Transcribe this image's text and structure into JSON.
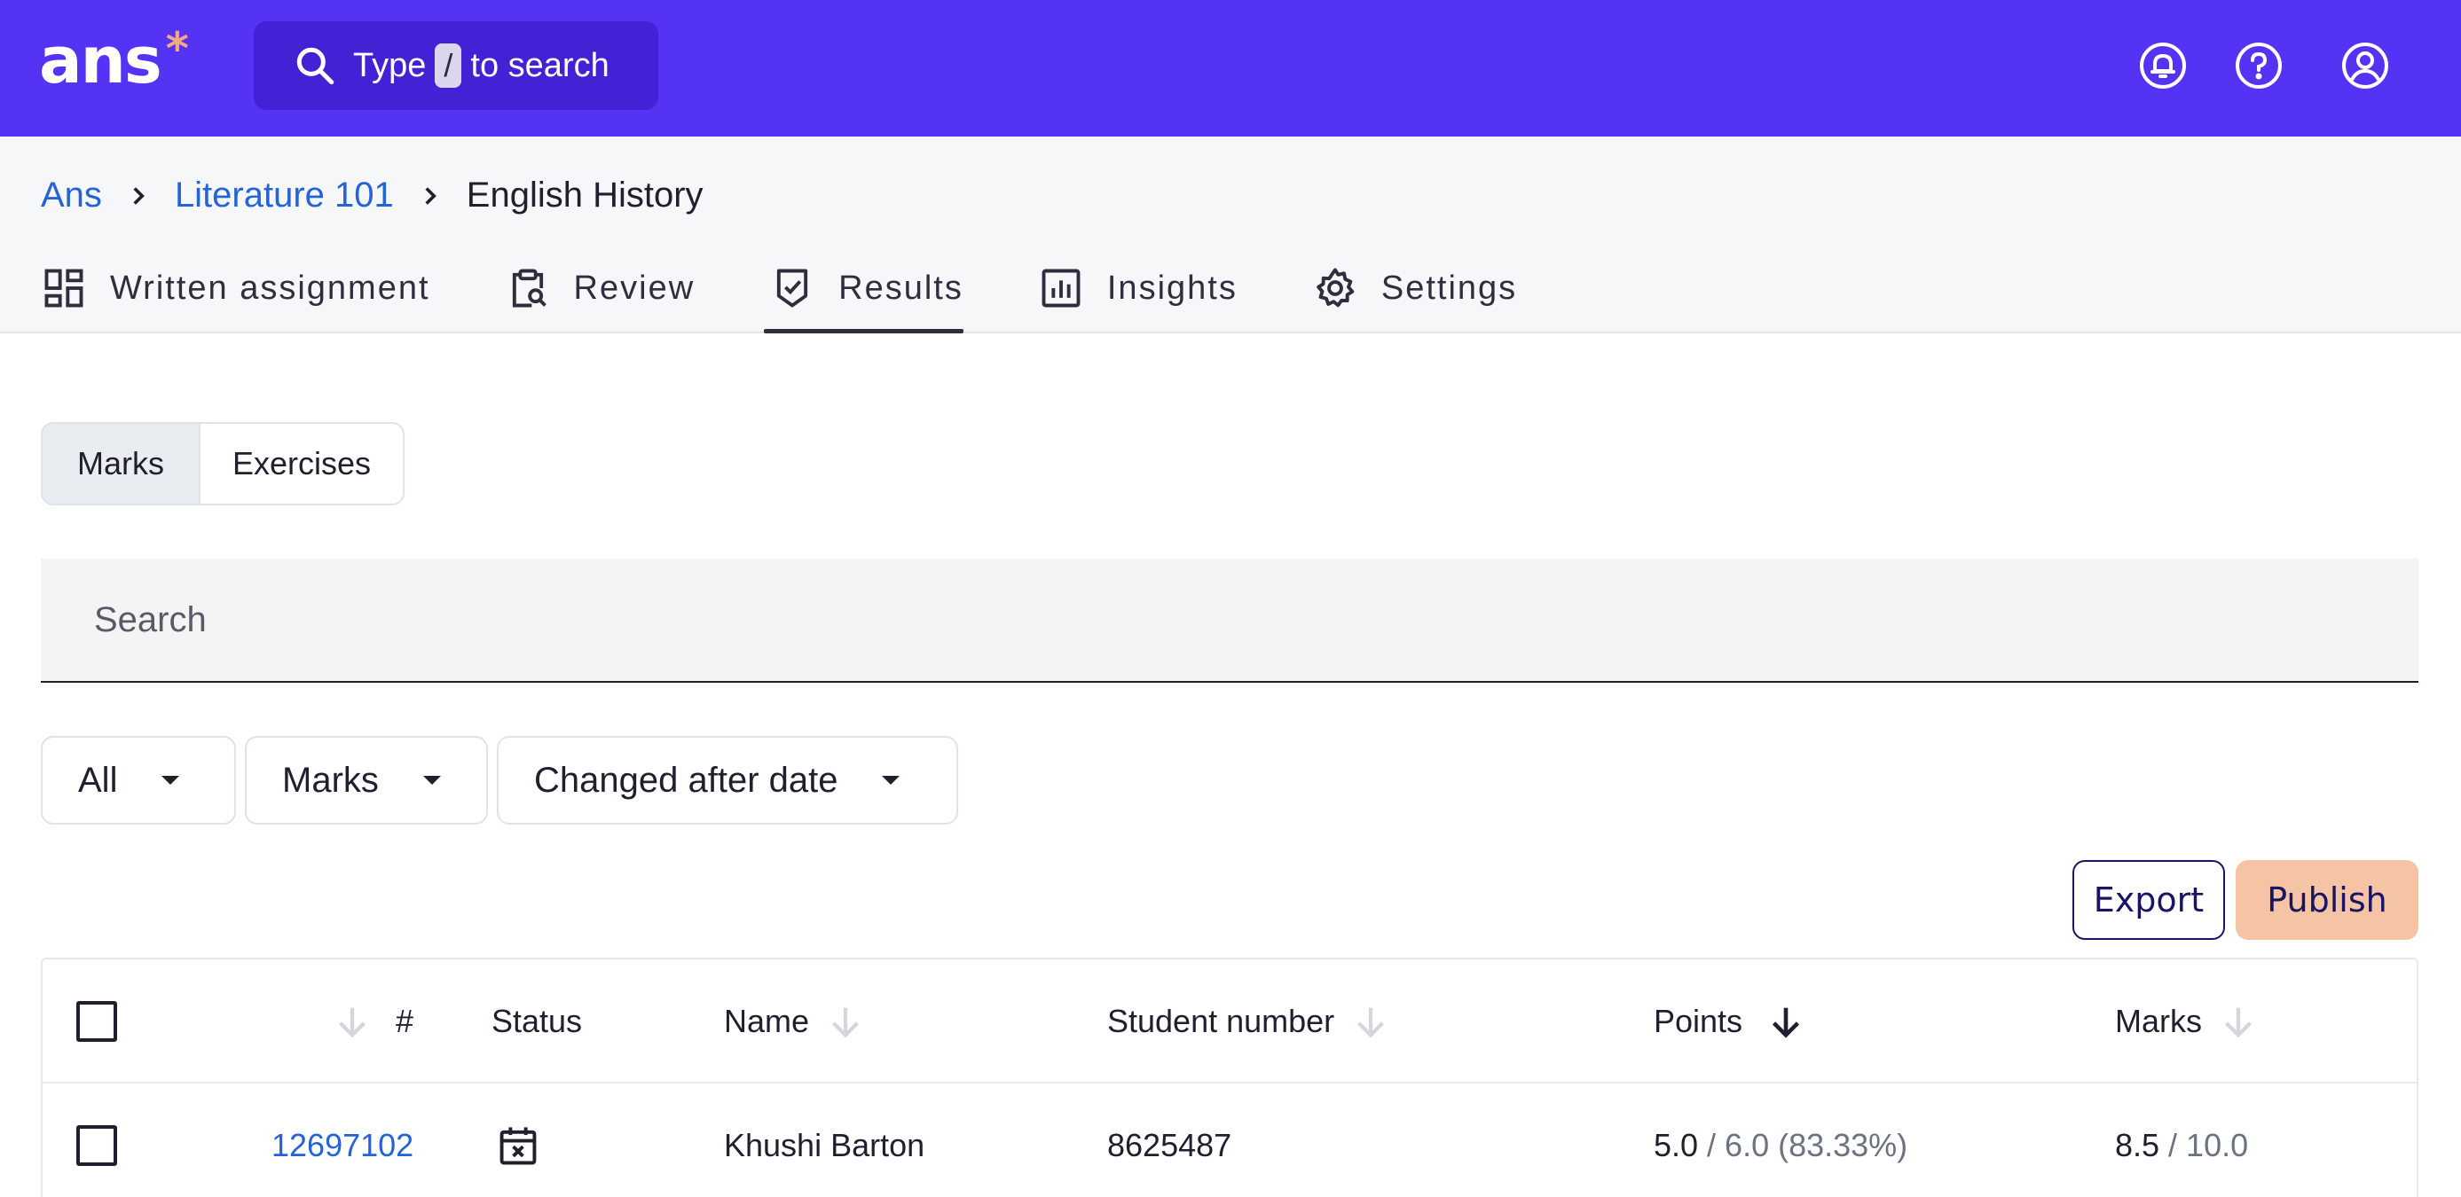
{
  "app": {
    "logo_text": "ans",
    "logo_star": "*",
    "brand_color": "#5533F5",
    "accent_color": "#F5A97F"
  },
  "search_bar": {
    "prefix": "Type",
    "key": "/",
    "suffix": "to search",
    "icon": "search-icon"
  },
  "top_icons": [
    "notification-bell-icon",
    "help-icon",
    "account-icon"
  ],
  "breadcrumb": {
    "items": [
      {
        "label": "Ans"
      },
      {
        "label": "Literature 101"
      },
      {
        "label": "English History"
      }
    ]
  },
  "tabs": [
    {
      "label": "Written assignment",
      "icon": "dashboard-icon",
      "active": false
    },
    {
      "label": "Review",
      "icon": "clipboard-search-icon",
      "active": false
    },
    {
      "label": "Results",
      "icon": "shield-check-icon",
      "active": true
    },
    {
      "label": "Insights",
      "icon": "bar-chart-icon",
      "active": false
    },
    {
      "label": "Settings",
      "icon": "gear-icon",
      "active": false
    }
  ],
  "view_toggle": {
    "options": [
      {
        "label": "Marks",
        "selected": true
      },
      {
        "label": "Exercises",
        "selected": false
      }
    ]
  },
  "search": {
    "placeholder": "Search",
    "value": ""
  },
  "filters": [
    {
      "label": "All"
    },
    {
      "label": "Marks"
    },
    {
      "label": "Changed after date"
    }
  ],
  "actions": {
    "export_label": "Export",
    "publish_label": "Publish"
  },
  "table": {
    "columns": [
      {
        "label": "#",
        "sortable": true,
        "sorted": false
      },
      {
        "label": "Status",
        "sortable": false
      },
      {
        "label": "Name",
        "sortable": true,
        "sorted": false
      },
      {
        "label": "Student number",
        "sortable": true,
        "sorted": false
      },
      {
        "label": "Points",
        "sortable": true,
        "sorted": true,
        "direction": "descending"
      },
      {
        "label": "Marks",
        "sortable": true,
        "sorted": false
      }
    ],
    "rows": [
      {
        "id": "12697102",
        "status_icon": "calendar-x-icon",
        "name": "Khushi Barton",
        "student_number": "8625487",
        "points_value": "5.0",
        "points_rest": "/ 6.0 (83.33%)",
        "marks_value": "8.5",
        "marks_rest": "/ 10.0"
      }
    ]
  }
}
